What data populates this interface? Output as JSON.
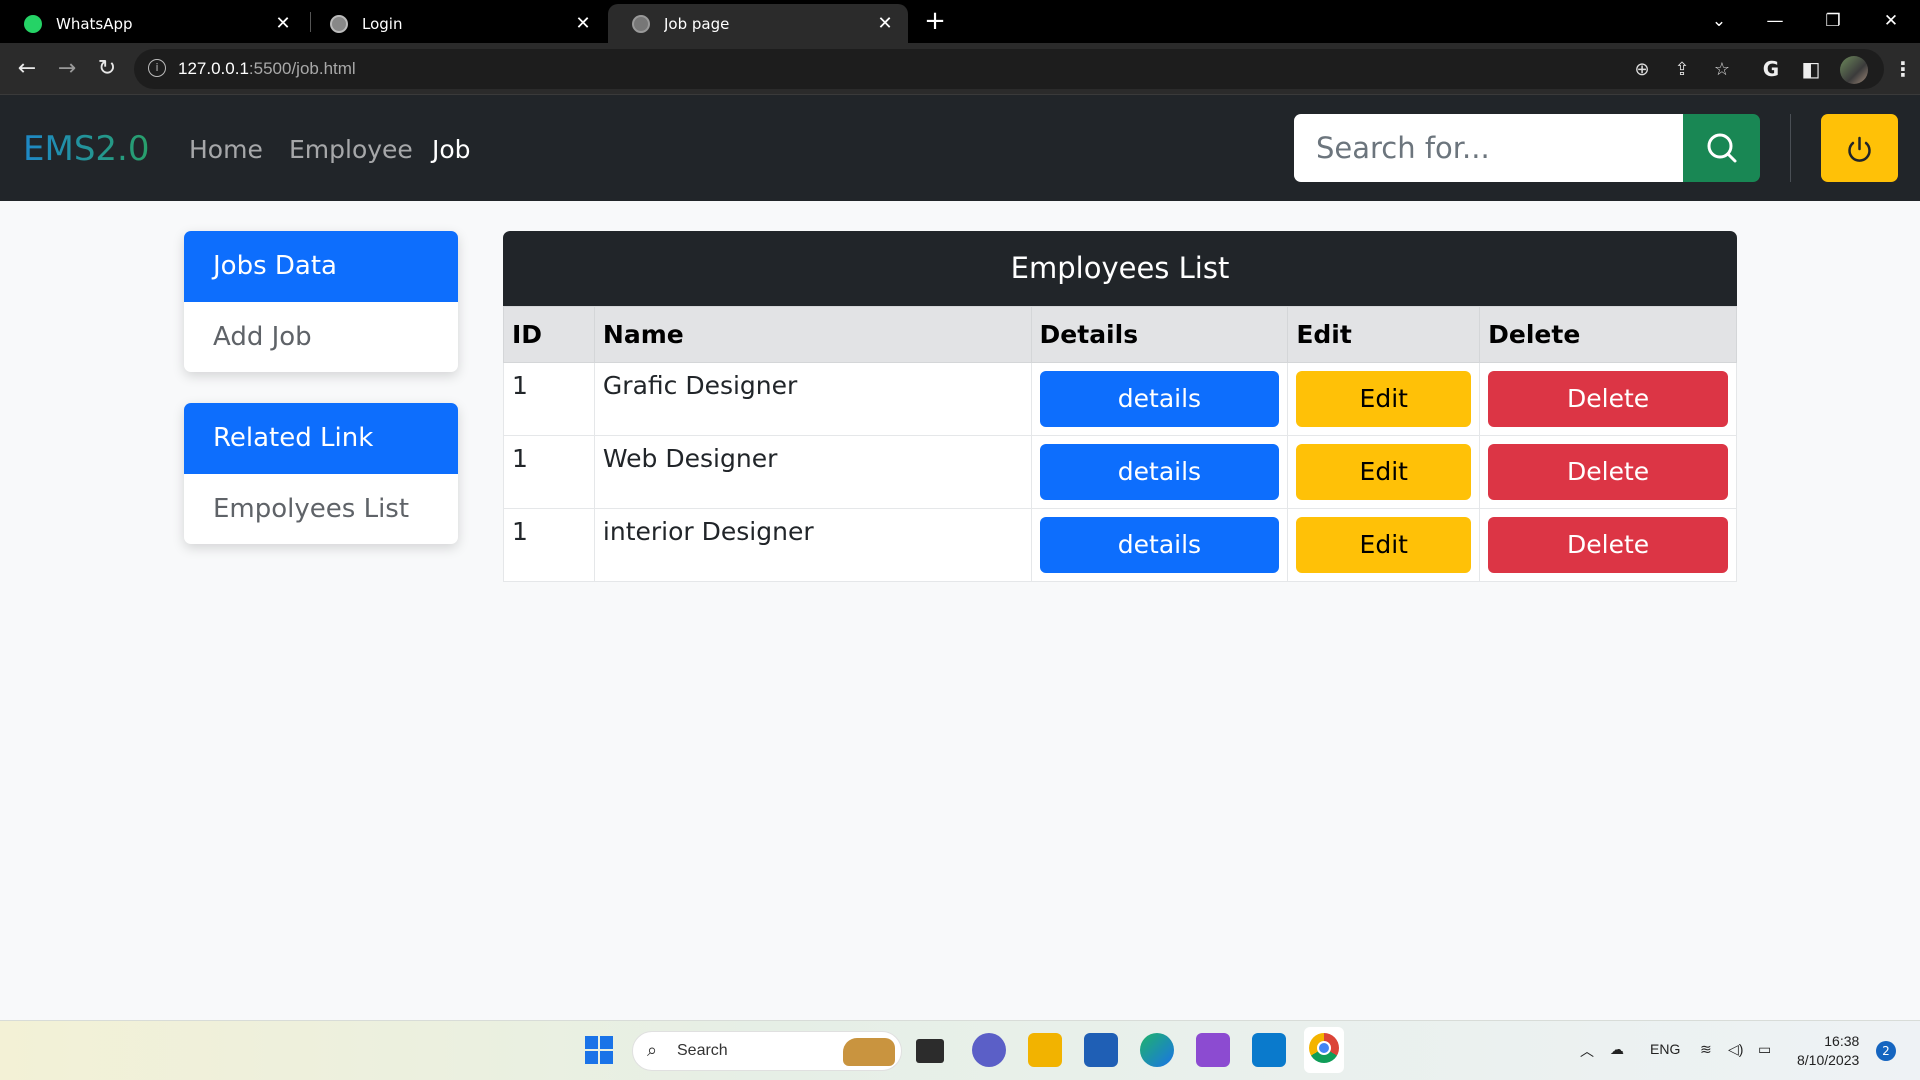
{
  "browser": {
    "tabs": [
      {
        "title": "WhatsApp",
        "close": "✕"
      },
      {
        "title": "Login",
        "close": "✕"
      },
      {
        "title": "Job page",
        "close": "✕"
      }
    ],
    "new_tab": "+",
    "url_host": "127.0.0.1",
    "url_path": ":5500/job.html"
  },
  "navbar": {
    "brand": "EMS2.0",
    "links": [
      {
        "label": "Home"
      },
      {
        "label": "Employee"
      },
      {
        "label": "Job"
      }
    ],
    "search_placeholder": "Search for..."
  },
  "sidebar": {
    "jobs_header": "Jobs Data",
    "jobs_item": "Add Job",
    "related_header": "Related Link",
    "related_item": "Empolyees List"
  },
  "table": {
    "title": "Employees List",
    "headers": [
      "ID",
      "Name",
      "Details",
      "Edit",
      "Delete"
    ],
    "rows": [
      {
        "id": "1",
        "name": "Grafic Designer",
        "details": "details",
        "edit": "Edit",
        "delete": "Delete"
      },
      {
        "id": "1",
        "name": "Web Designer",
        "details": "details",
        "edit": "Edit",
        "delete": "Delete"
      },
      {
        "id": "1",
        "name": "interior Designer",
        "details": "details",
        "edit": "Edit",
        "delete": "Delete"
      }
    ]
  },
  "taskbar": {
    "search_label": "Search",
    "lang": "ENG",
    "time": "16:38",
    "date": "8/10/2023",
    "notifications": "2"
  },
  "colors": {
    "primary": "#0d6efd",
    "success": "#198754",
    "warning": "#ffc107",
    "danger": "#dc3545",
    "dark": "#212529"
  }
}
